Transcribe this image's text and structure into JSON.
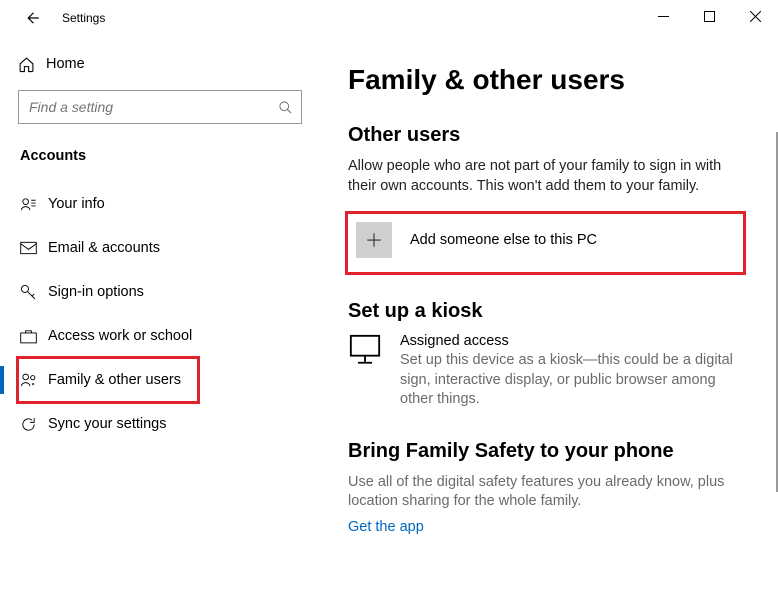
{
  "window": {
    "title": "Settings"
  },
  "sidebar": {
    "home_label": "Home",
    "search_placeholder": "Find a setting",
    "section_label": "Accounts",
    "items": [
      {
        "label": "Your info"
      },
      {
        "label": "Email & accounts"
      },
      {
        "label": "Sign-in options"
      },
      {
        "label": "Access work or school"
      },
      {
        "label": "Family & other users"
      },
      {
        "label": "Sync your settings"
      }
    ]
  },
  "main": {
    "page_title": "Family & other users",
    "other_users": {
      "heading": "Other users",
      "description": "Allow people who are not part of your family to sign in with their own accounts. This won't add them to your family.",
      "add_label": "Add someone else to this PC"
    },
    "kiosk": {
      "heading": "Set up a kiosk",
      "title": "Assigned access",
      "description": "Set up this device as a kiosk—this could be a digital sign, interactive display, or public browser among other things."
    },
    "family_safety": {
      "heading": "Bring Family Safety to your phone",
      "description": "Use all of the digital safety features you already know, plus location sharing for the whole family.",
      "link_label": "Get the app"
    }
  }
}
